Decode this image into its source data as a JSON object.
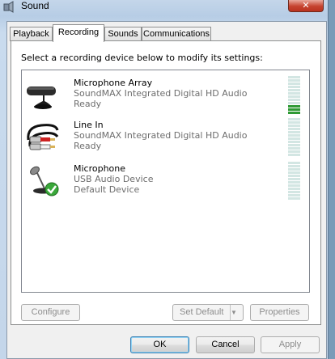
{
  "window": {
    "title": "Sound",
    "close_label": "✕"
  },
  "tabs": [
    {
      "label": "Playback",
      "active": false
    },
    {
      "label": "Recording",
      "active": true
    },
    {
      "label": "Sounds",
      "active": false
    },
    {
      "label": "Communications",
      "active": false
    }
  ],
  "recording": {
    "instruction": "Select a recording device below to modify its settings:",
    "devices": [
      {
        "name": "Microphone Array",
        "driver": "SoundMAX Integrated Digital HD Audio",
        "status": "Ready",
        "icon": "microphone-array-icon",
        "level_bars_on": 3,
        "level_bars_total": 12
      },
      {
        "name": "Line In",
        "driver": "SoundMAX Integrated Digital HD Audio",
        "status": "Ready",
        "icon": "line-in-cable-icon",
        "level_bars_on": 0,
        "level_bars_total": 12
      },
      {
        "name": "Microphone",
        "driver": "USB Audio Device",
        "status": "Default Device",
        "icon": "microphone-default-icon",
        "level_bars_on": 0,
        "level_bars_total": 12
      }
    ],
    "buttons": {
      "configure": "Configure",
      "set_default": "Set Default",
      "set_default_arrow": "▼",
      "properties": "Properties"
    }
  },
  "dialog_buttons": {
    "ok": "OK",
    "cancel": "Cancel",
    "apply": "Apply"
  },
  "colors": {
    "level_on": "#2f9a35",
    "level_off": "#d3e6e3",
    "default_check": "#3aa83a"
  }
}
